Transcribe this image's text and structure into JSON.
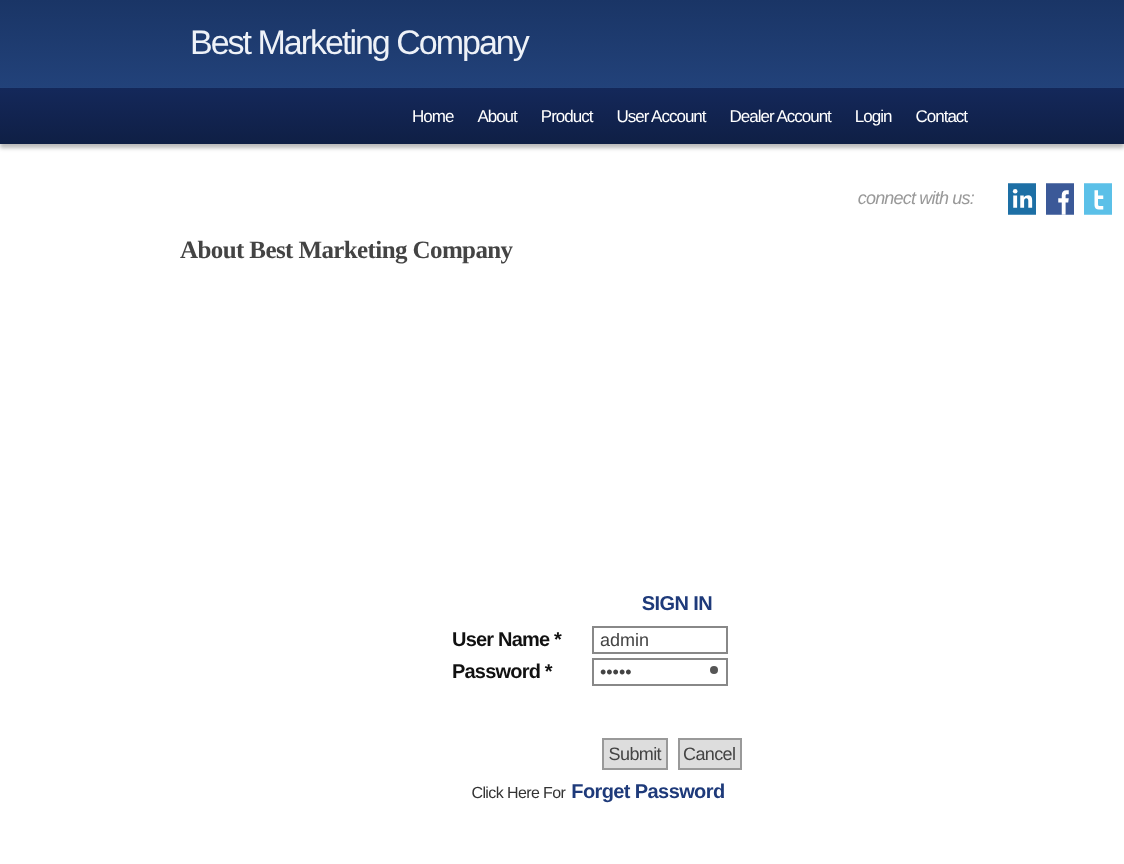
{
  "header": {
    "title": "Best Marketing Company"
  },
  "nav": [
    {
      "label": "Home"
    },
    {
      "label": "About"
    },
    {
      "label": "Product"
    },
    {
      "label": "User Account"
    },
    {
      "label": "Dealer Account"
    },
    {
      "label": "Login"
    },
    {
      "label": "Contact"
    }
  ],
  "social": {
    "label": "connect with us:",
    "icons": [
      {
        "kind": "linkedin"
      },
      {
        "kind": "facebook"
      },
      {
        "kind": "twitter"
      }
    ]
  },
  "heading": "About Best Marketing Company",
  "signin": {
    "title": "SIGN IN",
    "fields": [
      {
        "label": "User Name *",
        "value": "admin"
      },
      {
        "label": "Password *",
        "value": "•••••"
      }
    ],
    "buttons": [
      "Submit",
      "Cancel"
    ],
    "forgot_prefix": "Click Here For",
    "forgot_link": "Forget Password"
  }
}
